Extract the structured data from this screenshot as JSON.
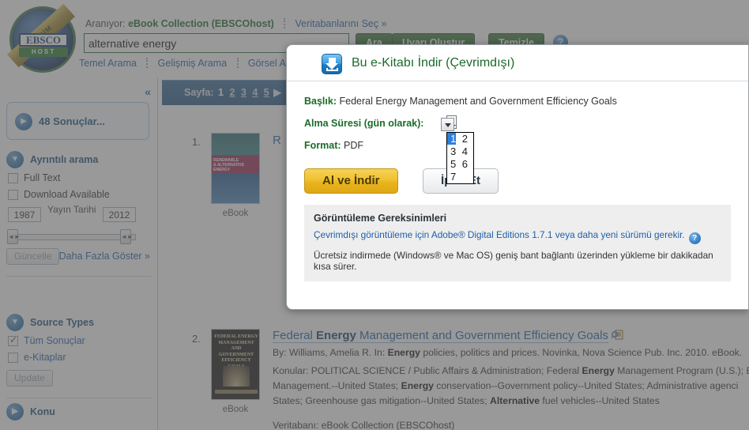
{
  "header": {
    "logo": {
      "sash": "BENİM",
      "brand": "EBSCO",
      "sub": "HOST"
    },
    "searching_label": "Aranıyor:",
    "database": "eBook Collection (EBSCOhost)",
    "choose_db_link": "Veritabanlarını Seç »",
    "search_value": "alternative energy",
    "search_placeholder": "",
    "buttons": {
      "search": "Ara",
      "create_alert": "Uyarı Oluştur",
      "clear": "Temizle"
    },
    "help_icon": "?",
    "nav": [
      {
        "label": "Temel Arama"
      },
      {
        "label": "Gelişmiş Arama"
      },
      {
        "label": "Görsel Arama"
      }
    ],
    "nav_more_arrow": "▶"
  },
  "results_bar": {
    "page_label": "Sayfa:",
    "pages": [
      "1",
      "2",
      "3",
      "4",
      "5"
    ],
    "current_page": "1",
    "next_arrow": "▶"
  },
  "sidebar": {
    "collapse_icon": "«",
    "results_count": "48 Sonuçlar...",
    "refine": {
      "title": "Ayrıntılı arama",
      "checkboxes": [
        {
          "label": "Full Text",
          "checked": false
        },
        {
          "label": "Download Available",
          "checked": false
        }
      ],
      "date_label": "Yayın Tarihi",
      "date_from": "1987",
      "date_to": "2012",
      "update_button": "Güncelle",
      "show_more": "Daha Fazla Göster »"
    },
    "source_types": {
      "title": "Source Types",
      "checkboxes": [
        {
          "label": "Tüm Sonuçlar",
          "checked": true
        },
        {
          "label": "e-Kitaplar",
          "checked": false
        }
      ],
      "update_button": "Update"
    },
    "subject": {
      "title": "Konu"
    }
  },
  "results": [
    {
      "number": "1.",
      "cover_caption": "eBook",
      "cover_text": "RENEWABLE & ALTERNATIVE ENERGY",
      "title_prefix": "R"
    },
    {
      "number": "2.",
      "cover_caption": "eBook",
      "cover_text": "FEDERAL ENERGY MANAGEMENT AND GOVERNMENT EFFICIENCY GOALS",
      "title_a": "Federal ",
      "title_b": "Energy",
      "title_c": " Management and Government Efficiency Goals",
      "line_by": "By: Williams, Amelia R. In: Energy policies, politics and prices. Novinka, Nova Science Pub. Inc. 2010. eBook. ",
      "line_by_a": "By: Williams, Amelia R. In: ",
      "line_by_b": "Energy",
      "line_by_c": " policies, politics and prices. Novinka, Nova Science Pub. Inc. 2010. eBook.",
      "subjects_label": "Konular: ",
      "subjects_1a": "POLITICAL SCIENCE / Public Affairs & Administration; Federal ",
      "subjects_1b": "Energy",
      "subjects_1c": " Management Program (U.S.); E",
      "subjects_2a": "Management.--United States; ",
      "subjects_2b": "Energy",
      "subjects_2c": " conservation--Government policy--United States; Administrative agenci",
      "subjects_3a": "States; Greenhouse gas mitigation--United States; ",
      "subjects_3b": "Alternative",
      "subjects_3c": " fuel vehicles--United States",
      "database_line": "Veritabanı: eBook Collection (EBSCOhost)"
    }
  ],
  "modal": {
    "title": "Bu e-Kitabı İndir (Çevrimdışı)",
    "icon": "download-icon",
    "fields": {
      "title_label": "Başlık:",
      "title_value": "Federal Energy Management and Government Efficiency Goals",
      "loan_label": "Alma Süresi (gün olarak):",
      "loan_value": "1",
      "loan_options": [
        "1",
        "2",
        "3",
        "4",
        "5",
        "6",
        "7"
      ],
      "format_label": "Format:",
      "format_value": "PDF"
    },
    "buttons": {
      "download": "Al ve İndir",
      "cancel": "İptal Et"
    },
    "requirements": {
      "title": "Görüntüleme Gereksinimleri",
      "line1": "Çevrimdışı görüntüleme için Adobe® Digital Editions 1.7.1 veya daha yeni sürümü gerekir.",
      "help_icon": "?",
      "line2": "Ücretsiz indirmede (Windows® ve Mac OS) geniş bant bağlantı üzerinden yükleme bir dakikadan kısa sürer."
    }
  },
  "colors": {
    "brand_green": "#1b6b2a",
    "link_blue": "#1f5fa9",
    "bar_blue": "#2b5b87",
    "gold": "#f0c131",
    "select_highlight": "#2a7fe0"
  }
}
